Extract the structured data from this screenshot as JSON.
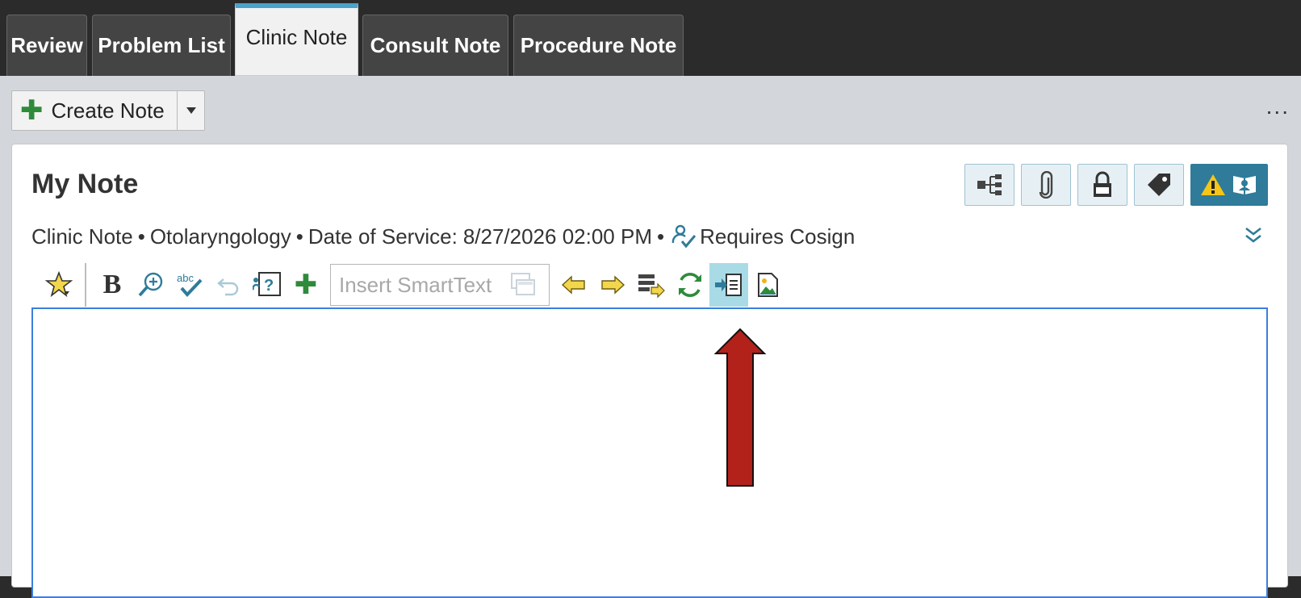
{
  "tabs": [
    {
      "label": "Review",
      "active": false
    },
    {
      "label": "Problem List",
      "active": false
    },
    {
      "label": "Clinic Note",
      "active": true
    },
    {
      "label": "Consult Note",
      "active": false
    },
    {
      "label": "Procedure Note",
      "active": false
    }
  ],
  "toolbar": {
    "create_note_label": "Create Note",
    "more_label": "..."
  },
  "note": {
    "title": "My Note",
    "note_type": "Clinic Note",
    "specialty": "Otolaryngology",
    "date_of_service_label": "Date of Service:",
    "date_of_service": "8/27/2026 02:00 PM",
    "separator": "•",
    "cosign_label": "Requires Cosign"
  },
  "editor": {
    "smarttext_placeholder": "Insert SmartText",
    "bold_label": "B",
    "spell_label": "abc",
    "highlighted_tool": "insert-file-icon"
  },
  "header_icons": [
    "share-tree-icon",
    "paperclip-icon",
    "lock-icon",
    "tag-icon",
    "warning-icon",
    "reader-icon"
  ],
  "colors": {
    "active_tab_accent": "#4aa3c9",
    "editor_border": "#3b7fdc",
    "annotation_arrow": "#b2211a",
    "alert_button": "#2f7b99",
    "plus_green": "#2e8b3b"
  }
}
